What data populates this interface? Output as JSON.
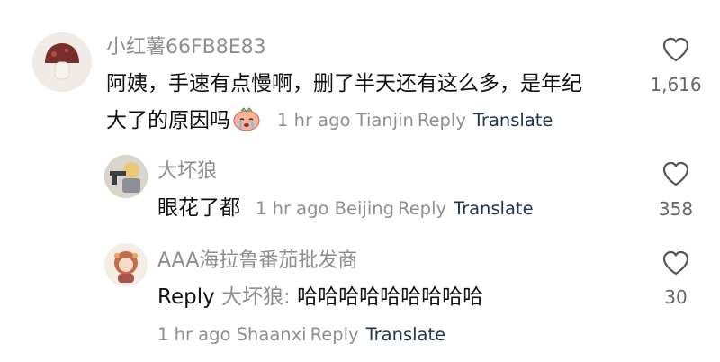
{
  "comments": [
    {
      "username": "小红薯66FB8E83",
      "text_line1": "阿姨，手速有点慢啊，删了半天还有这么多，是年纪",
      "text_line2": "大了的原因吗",
      "time": "1 hr ago",
      "location": "Tianjin",
      "reply_label": "Reply",
      "translate_label": "Translate",
      "likes": "1,616",
      "emoji": "crying-face-emoji"
    },
    {
      "username": "大坏狼",
      "text": "眼花了都",
      "time": "1 hr ago",
      "location": "Beijing",
      "reply_label": "Reply",
      "translate_label": "Translate",
      "likes": "358"
    },
    {
      "username": "AAA海拉鲁番茄批发商",
      "reply_prefix": "Reply",
      "reply_target": "大坏狼:",
      "text": "哈哈哈哈哈哈哈哈哈",
      "time": "1 hr ago",
      "location": "Shaanxi",
      "reply_label": "Reply",
      "translate_label": "Translate",
      "likes": "30"
    }
  ],
  "colors": {
    "meta": "#8e8e8e",
    "translate": "#1f3550",
    "text": "#111111"
  }
}
